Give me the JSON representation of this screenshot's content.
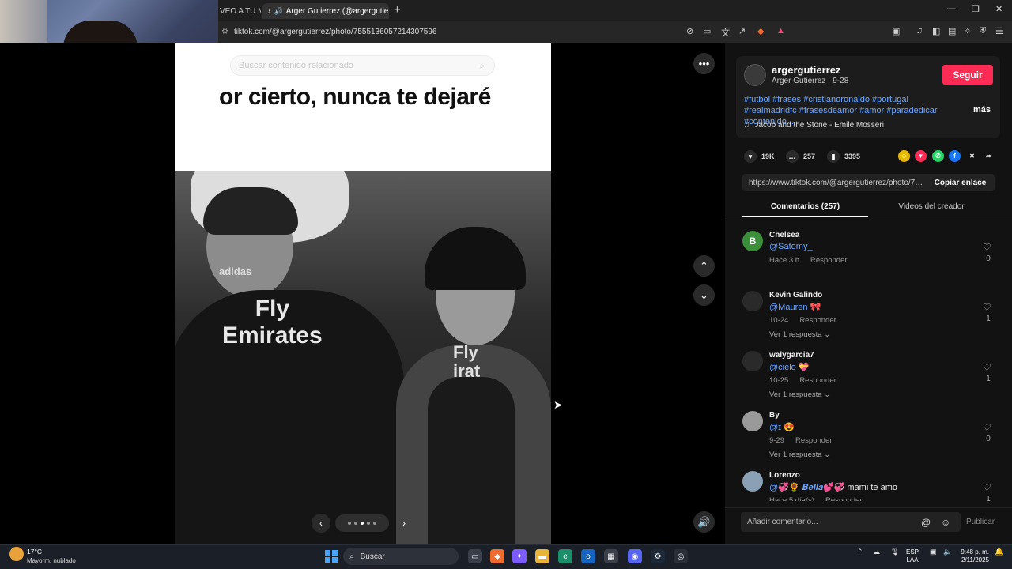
{
  "browser": {
    "tab_partial": "VEO A TU M",
    "tab_active": "Arger Gutierrez (@argergutie",
    "url": "tiktok.com/@argergutierrez/photo/7555136057214307596"
  },
  "post": {
    "search_placeholder": "Buscar contenido relacionado",
    "caption": "or cierto, nunca te dejaré",
    "jersey_line1": "Fly",
    "jersey_line2": "Emirates",
    "jersey_small": "adidas",
    "jersey_right": "Fly\nirat",
    "carousel_dots": 5,
    "carousel_active": 3
  },
  "creator": {
    "username": "argergutierrez",
    "subtitle": "Arger Gutierrez · 9-28",
    "follow_label": "Seguir",
    "hashtags": "#fútbol #frases #cristianoronaldo #portugal #realmadridfc #frasesdeamor #amor #paradedicar #contenido...",
    "more_label": "más",
    "music": "Jacob and the Stone - Emile Mosseri"
  },
  "stats": {
    "likes": "19K",
    "comments": "257",
    "saves": "3395"
  },
  "share_link": {
    "url": "https://www.tiktok.com/@argergutierrez/photo/75...",
    "copy_label": "Copiar enlace"
  },
  "tabs": {
    "comments": "Comentarios (257)",
    "videos": "Videos del creador"
  },
  "comments": [
    {
      "initial": "B",
      "user": "Chelsea",
      "text": "@Satomy_",
      "extra": "",
      "date": "Hace 3 h",
      "reply": "Responder",
      "replies": "",
      "likes": "0",
      "avatar_color": "#3b8f3b"
    },
    {
      "initial": "",
      "user": "Kevin Galindo",
      "text": "@Mauren",
      "extra": "🎀",
      "date": "10-24",
      "reply": "Responder",
      "replies": "Ver 1 respuesta",
      "likes": "1",
      "avatar_color": "#2a2a2a"
    },
    {
      "initial": "",
      "user": "walygarcia7",
      "text": "@cielo",
      "extra": "💝",
      "date": "10-25",
      "reply": "Responder",
      "replies": "Ver 1 respuesta",
      "likes": "1",
      "avatar_color": "#2a2a2a"
    },
    {
      "initial": "",
      "user": "By",
      "text": "@ɪ",
      "extra": "😍",
      "date": "9-29",
      "reply": "Responder",
      "replies": "Ver 1 respuesta",
      "likes": "0",
      "avatar_color": "#9a9a9a"
    },
    {
      "initial": "",
      "user": "Lorenzo",
      "text": "@💞🌻 𝑩𝒆𝒍𝒍𝒂💕💞",
      "extra": "mami te amo",
      "date": "Hace 5 día(s)",
      "reply": "Responder",
      "replies": "",
      "likes": "1",
      "avatar_color": "#8aa0b4"
    }
  ],
  "composer": {
    "placeholder": "Añadir comentario...",
    "publish": "Publicar"
  },
  "taskbar": {
    "temp": "17°C",
    "weather": "Mayorm. nublado",
    "search": "Buscar",
    "lang1": "ESP",
    "lang2": "LAA",
    "time": "9:48 p. m.",
    "date": "2/11/2025"
  },
  "colors": {
    "accent": "#fe2c55",
    "link": "#6fa8ff",
    "panel": "#121212"
  }
}
